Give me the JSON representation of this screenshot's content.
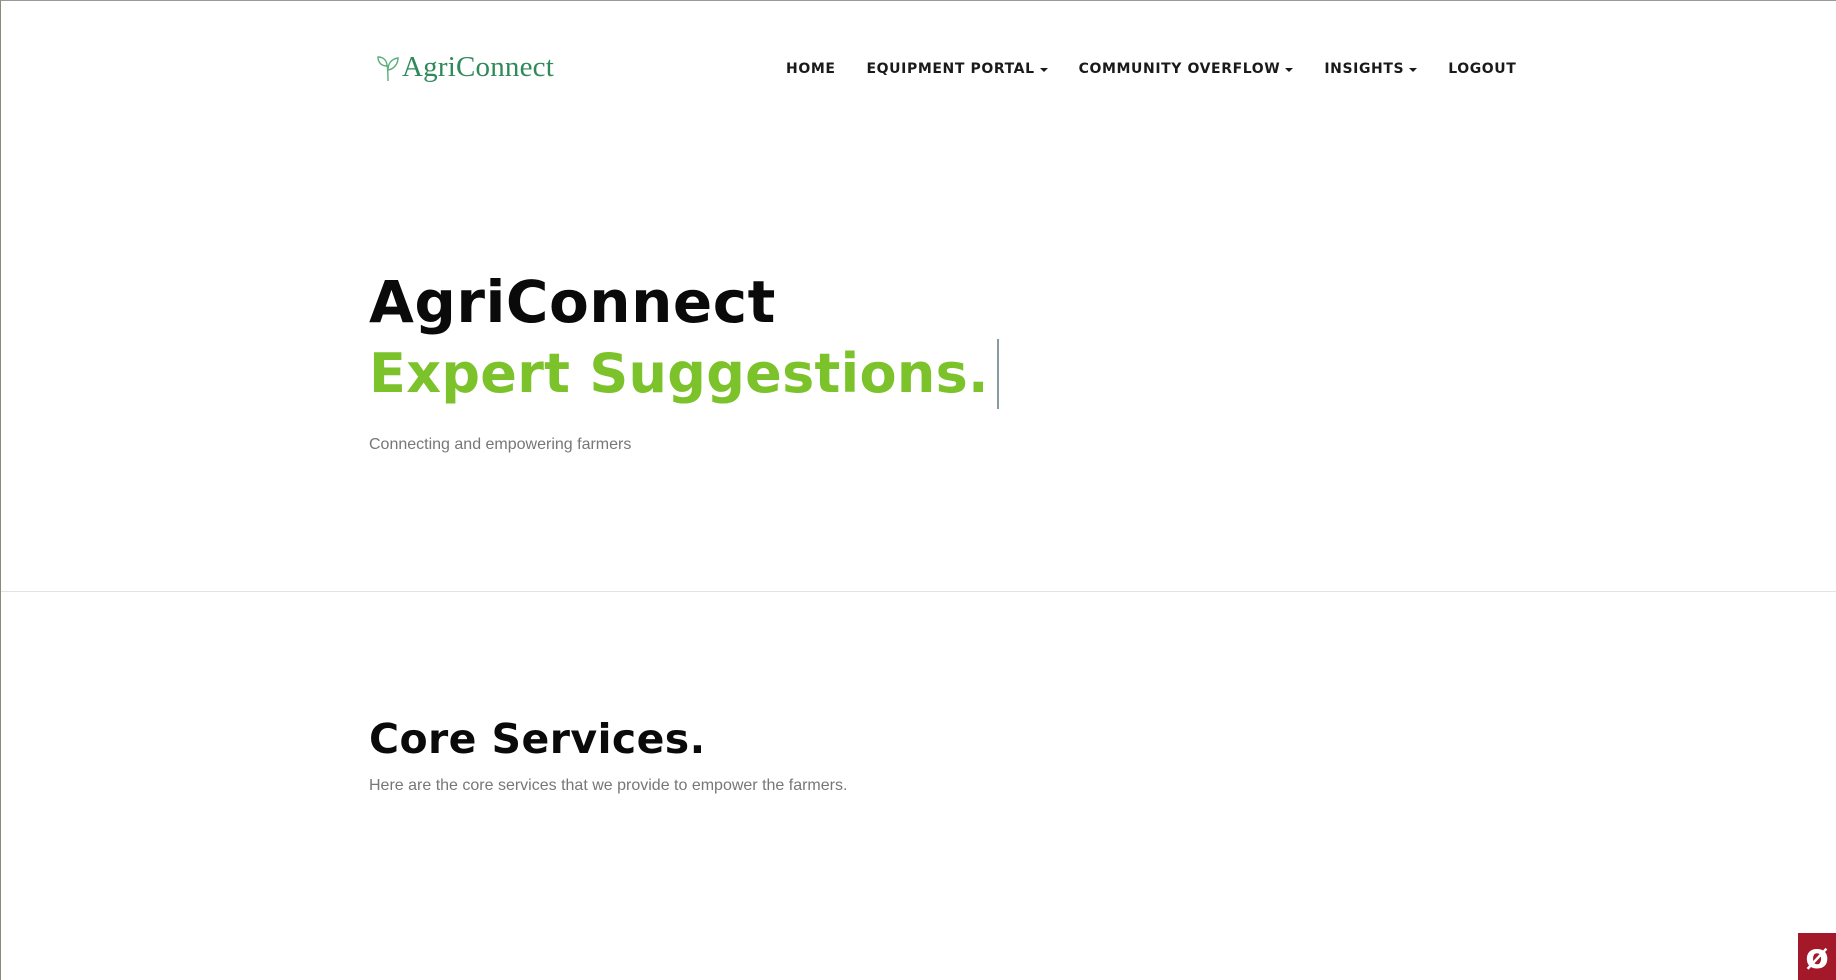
{
  "header": {
    "brand": {
      "name": "AgriConnect",
      "icon": "leaf-sprout-icon",
      "color": "#2f8a5a"
    },
    "nav": [
      {
        "label": "HOME",
        "dropdown": false
      },
      {
        "label": "EQUIPMENT PORTAL",
        "dropdown": true
      },
      {
        "label": "COMMUNITY OVERFLOW",
        "dropdown": true
      },
      {
        "label": "INSIGHTS",
        "dropdown": true
      },
      {
        "label": "LOGOUT",
        "dropdown": false
      }
    ]
  },
  "hero": {
    "title": "AgriConnect",
    "typed_text": "Expert Suggestions.",
    "typed_color": "#7cc22a",
    "subtitle": "Connecting and empowering farmers"
  },
  "services": {
    "title": "Core Services.",
    "description": "Here are the core services that we provide to empower the farmers."
  },
  "corner_badge": {
    "symbol": "ø",
    "icon": "slashed-o-icon",
    "color": "#a3192a"
  }
}
